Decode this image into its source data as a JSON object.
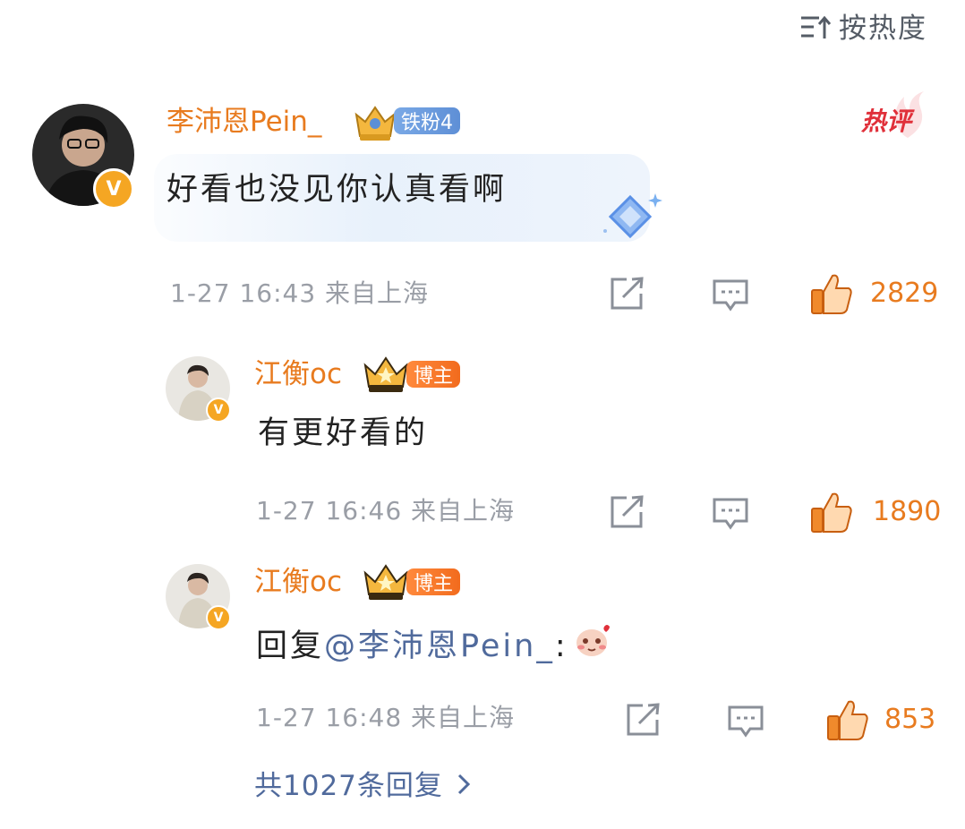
{
  "sort": {
    "label": "按热度",
    "icon": "sort-icon"
  },
  "colors": {
    "username": "#e87b1f",
    "likes": "#e87b1f",
    "meta": "#9a9ea6",
    "link": "#506a9c",
    "hot": "#e0303a"
  },
  "main_comment": {
    "username": "李沛恩Pein_",
    "badge_label": "铁粉4",
    "hot_label": "热评",
    "text": "好看也没见你认真看啊",
    "meta": "1-27 16:43 来自上海",
    "likes": "2829",
    "verified_icon": "verified-v-icon"
  },
  "replies": [
    {
      "username": "江衡oc",
      "badge_label": "博主",
      "text": "有更好看的",
      "meta": "1-27 16:46 来自上海",
      "likes": "1890"
    },
    {
      "username": "江衡oc",
      "badge_label": "博主",
      "reply_prefix": "回复",
      "mention": "@李沛恩Pein_",
      "colon": ":",
      "emoji_icon": "blush-emoji-icon",
      "meta": "1-27 16:48 来自上海",
      "likes": "853"
    }
  ],
  "more_replies": {
    "label": "共1027条回复"
  },
  "verified_mark": "V"
}
